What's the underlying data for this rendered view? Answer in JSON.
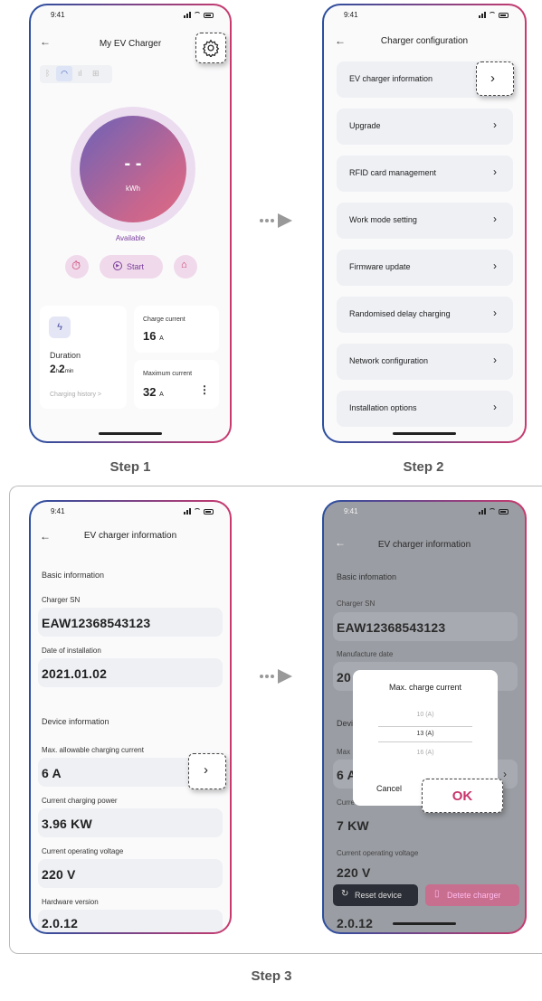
{
  "steps": {
    "s1": "Step 1",
    "s2": "Step 2",
    "s3": "Step 3"
  },
  "screen1": {
    "time": "9:41",
    "title": "My EV Charger",
    "energy_value": "- -",
    "energy_unit": "kWh",
    "status": "Available",
    "start_label": "Start",
    "duration_label": "Duration",
    "duration_h": "2",
    "duration_h_unit": "h",
    "duration_m": "2",
    "duration_m_unit": "min",
    "history_link": "Charging history >",
    "charge_current_label": "Charge current",
    "charge_current_value": "16",
    "charge_current_unit": "A",
    "max_current_label": "Maximum current",
    "max_current_value": "32",
    "max_current_unit": "A",
    "icons": [
      "bluetooth-icon",
      "wifi-icon",
      "cellular-icon",
      "ethernet-icon",
      "gear-icon",
      "timer-icon",
      "play-icon",
      "unlock-icon",
      "lightning-icon",
      "more-icon"
    ]
  },
  "screen2": {
    "time": "9:41",
    "title": "Charger configuration",
    "items": [
      "EV charger information",
      "Upgrade",
      "RFID card management",
      "Work mode setting",
      "Firmware update",
      "Randomised delay charging",
      "Network configuration",
      "Installation options"
    ]
  },
  "screen3": {
    "time": "9:41",
    "title": "EV charger information",
    "basic_section": "Basic information",
    "sn_label": "Charger SN",
    "sn_value": "EAW12368543123",
    "install_label": "Date of installation",
    "install_value": "2021.01.02",
    "device_section": "Device information",
    "max_current_label": "Max. allowable charging current",
    "max_current_value": "6 A",
    "power_label": "Current charging power",
    "power_value": "3.96 KW",
    "voltage_label": "Current operating voltage",
    "voltage_value": "220 V",
    "hw_label": "Hardware version",
    "hw_value": "2.0.12"
  },
  "screen4": {
    "time": "9:41",
    "title": "EV charger information",
    "basic_section": "Basic infomation",
    "sn_label": "Charger SN",
    "sn_value": "EAW12368543123",
    "manu_label": "Manufacture date",
    "manu_value": "20",
    "device_section": "Devi",
    "max_label": "Max",
    "max_value": "6 A",
    "power_label": "Curre",
    "power_value": "7 KW",
    "voltage_label": "Current operating voltage",
    "voltage_value": "220 V",
    "hw_value": "2.0.12",
    "reset_label": "Reset device",
    "delete_label": "Detete charger",
    "dialog_title": "Max. charge current",
    "options": [
      "10 (A)",
      "13 (A)",
      "16 (A)"
    ],
    "selected": "13 (A)",
    "cancel_label": "Cancel",
    "ok_label": "OK"
  },
  "colors": {
    "accent": "#c8356b",
    "purple": "#7b5ea7",
    "dark": "#2b2e36"
  }
}
